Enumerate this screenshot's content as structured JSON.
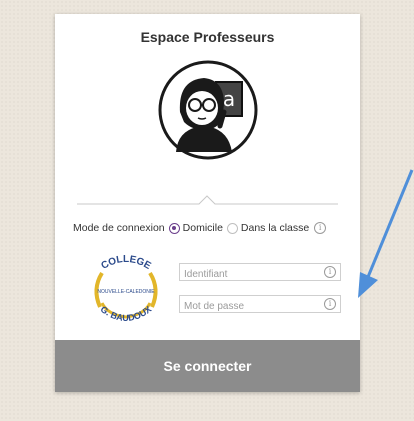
{
  "header": {
    "title": "Espace Professeurs"
  },
  "login": {
    "mode_label": "Mode de connexion",
    "mode_options": [
      "Domicile",
      "Dans la classe"
    ],
    "mode_selected": "Domicile",
    "username_placeholder": "Identifiant",
    "password_placeholder": "Mot de passe",
    "submit_label": "Se connecter"
  },
  "logo": {
    "top_text": "COLLEGE",
    "middle_text": "NOUVELLE-CALEDONIE",
    "bottom_text": "G. BAUDOUX"
  },
  "colors": {
    "radio_accent": "#6b3f8c",
    "button_bg": "#8c8c8c",
    "arrow": "#4f8fd9",
    "logo_gold": "#e2b62a",
    "logo_blue": "#2b4a8b"
  },
  "icons": [
    "teacher-avatar-icon",
    "info-icon",
    "arrow-annotation"
  ]
}
